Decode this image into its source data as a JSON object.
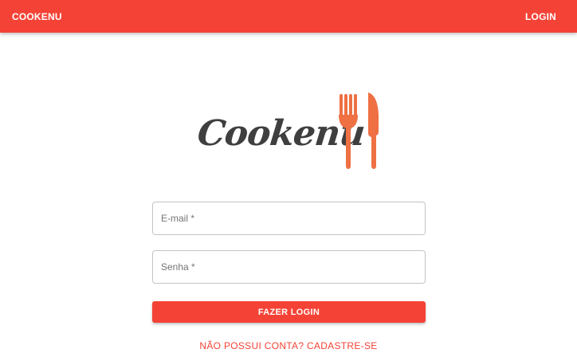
{
  "appbar": {
    "brand": "COOKENU",
    "login_label": "LOGIN",
    "color": "#f44336"
  },
  "logo": {
    "wordmark": "Cookenu",
    "icon": "fork-knife-icon",
    "icon_color": "#ee7043"
  },
  "form": {
    "email_placeholder": "E-mail *",
    "email_value": "",
    "password_placeholder": "Senha *",
    "password_value": "",
    "submit_label": "FAZER LOGIN",
    "signup_link": "NÃO POSSUI CONTA? CADASTRE-SE"
  }
}
